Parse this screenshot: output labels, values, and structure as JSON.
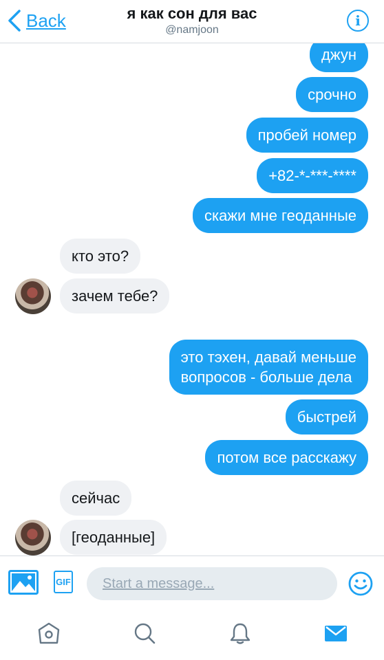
{
  "header": {
    "back_label": "Back",
    "title": "я как сон для вас",
    "subtitle": "@namjoon",
    "info_icon": "i"
  },
  "messages": [
    {
      "dir": "out",
      "text": "джун"
    },
    {
      "dir": "out",
      "text": "срочно"
    },
    {
      "dir": "out",
      "text": "пробей номер"
    },
    {
      "dir": "out",
      "text": "+82-*-***-****"
    },
    {
      "dir": "out",
      "text": "скажи мне геоданные"
    },
    {
      "dir": "in",
      "text": "кто это?"
    },
    {
      "dir": "in",
      "text": "зачем тебе?",
      "avatar": true
    },
    {
      "dir": "out",
      "text": "это тэхен, давай меньше\nвопросов - больше дела"
    },
    {
      "dir": "out",
      "text": "быстрей"
    },
    {
      "dir": "out",
      "text": "потом все расскажу"
    },
    {
      "dir": "in",
      "text": "сейчас"
    },
    {
      "dir": "in",
      "text": "[геоданные]",
      "avatar": true
    }
  ],
  "composer": {
    "placeholder": "Start a message...",
    "gif_label": "GIF"
  },
  "icons": [
    "chevron-left-icon",
    "info-icon",
    "photo-icon",
    "gif-icon",
    "emoji-icon",
    "home-icon",
    "search-icon",
    "notifications-icon",
    "messages-icon"
  ],
  "colors": {
    "accent": "#1da1f2",
    "incoming_bubble": "#eff1f4",
    "outgoing_text": "#ffffff"
  }
}
